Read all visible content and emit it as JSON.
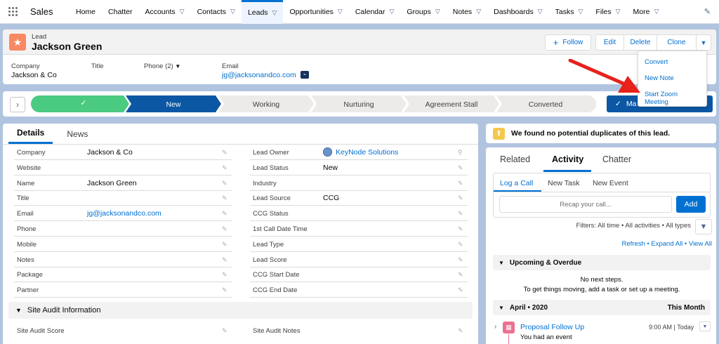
{
  "nav": {
    "app_name": "Sales",
    "tabs": [
      {
        "label": "Home",
        "chevron": false
      },
      {
        "label": "Chatter",
        "chevron": false
      },
      {
        "label": "Accounts",
        "chevron": true
      },
      {
        "label": "Contacts",
        "chevron": true
      },
      {
        "label": "Leads",
        "chevron": true,
        "active": true
      },
      {
        "label": "Opportunities",
        "chevron": true
      },
      {
        "label": "Calendar",
        "chevron": true
      },
      {
        "label": "Groups",
        "chevron": true
      },
      {
        "label": "Notes",
        "chevron": true
      },
      {
        "label": "Dashboards",
        "chevron": true
      },
      {
        "label": "Tasks",
        "chevron": true
      },
      {
        "label": "Files",
        "chevron": true
      },
      {
        "label": "More",
        "chevron": true
      }
    ]
  },
  "header": {
    "object_label": "Lead",
    "record_name": "Jackson Green",
    "follow_label": "Follow",
    "edit_label": "Edit",
    "delete_label": "Delete",
    "clone_label": "Clone",
    "fields": {
      "company_label": "Company",
      "company_value": "Jackson & Co",
      "title_label": "Title",
      "phone_label": "Phone (2)",
      "email_label": "Email",
      "email_value": "jg@jacksonandco.com"
    }
  },
  "dropdown_menu": {
    "items": [
      "Convert",
      "New Note",
      "Start Zoom Meeting"
    ]
  },
  "path": {
    "stages": [
      "",
      "New",
      "Working",
      "Nurturing",
      "Agreement Stall",
      "Converted"
    ],
    "button_label": "Mark Status as Complete",
    "button_visible_label": "Ma"
  },
  "details": {
    "tabs": [
      "Details",
      "News"
    ],
    "left_fields": [
      {
        "label": "Company",
        "value": "Jackson & Co"
      },
      {
        "label": "Website",
        "value": ""
      },
      {
        "label": "Name",
        "value": "Jackson Green"
      },
      {
        "label": "Title",
        "value": ""
      },
      {
        "label": "Email",
        "value": "jg@jacksonandco.com"
      },
      {
        "label": "Phone",
        "value": ""
      },
      {
        "label": "Mobile",
        "value": ""
      },
      {
        "label": "Notes",
        "value": ""
      },
      {
        "label": "Package",
        "value": ""
      },
      {
        "label": "Partner",
        "value": ""
      }
    ],
    "right_fields": [
      {
        "label": "Lead Owner",
        "value": "KeyNode Solutions"
      },
      {
        "label": "Lead Status",
        "value": "New"
      },
      {
        "label": "Industry",
        "value": ""
      },
      {
        "label": "Lead Source",
        "value": "CCG"
      },
      {
        "label": "CCG Status",
        "value": ""
      },
      {
        "label": "1st Call Date Time",
        "value": ""
      },
      {
        "label": "Lead Type",
        "value": ""
      },
      {
        "label": "Lead Score",
        "value": ""
      },
      {
        "label": "CCG Start Date",
        "value": ""
      },
      {
        "label": "CCG End Date",
        "value": ""
      }
    ],
    "section_title": "Site Audit Information",
    "section_fields": [
      {
        "label": "Site Audit Score"
      },
      {
        "label": "Site Audit Notes"
      }
    ]
  },
  "duplicates": {
    "message": "We found no potential duplicates of this lead."
  },
  "activity": {
    "tabs": [
      "Related",
      "Activity",
      "Chatter"
    ],
    "composer_tabs": [
      "Log a Call",
      "New Task",
      "New Event"
    ],
    "input_placeholder": "Recap your call...",
    "add_label": "Add",
    "filters_text": "Filters: All time • All activities • All types",
    "links": [
      "Refresh",
      "Expand All",
      "View All"
    ],
    "upcoming_title": "Upcoming & Overdue",
    "no_steps": "No next steps.",
    "no_steps_hint": "To get things moving, add a task or set up a meeting.",
    "month_title": "April • 2020",
    "month_right": "This Month",
    "event": {
      "title": "Proposal Follow Up",
      "subtitle": "You had an event",
      "time": "9:00 AM | Today"
    }
  },
  "colors": {
    "brand": "#0070d2",
    "completed_stage": "#4bca81",
    "current_stage": "#0b57a4",
    "lead_icon": "#f88962",
    "annotation_arrow": "#e8211b"
  }
}
